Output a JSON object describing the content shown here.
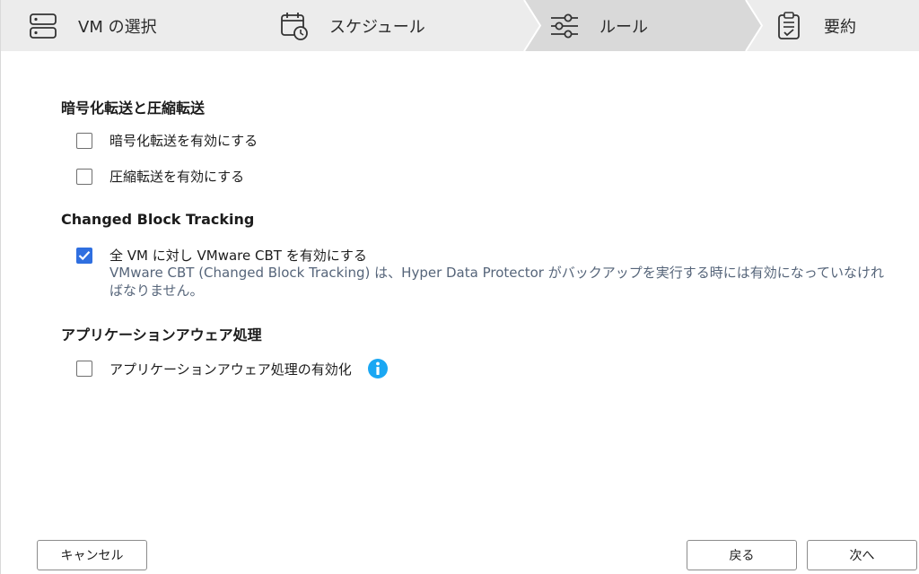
{
  "wizard": {
    "steps": [
      {
        "label": "VM の選択",
        "icon": "server-icon",
        "active": false
      },
      {
        "label": "スケジュール",
        "icon": "calendar-clock-icon",
        "active": false
      },
      {
        "label": "ルール",
        "icon": "sliders-icon",
        "active": true
      },
      {
        "label": "要約",
        "icon": "clipboard-check-icon",
        "active": false
      }
    ],
    "active_color": "#d9d9d9",
    "bar_color": "#ececec"
  },
  "transfer": {
    "title": "暗号化転送と圧縮転送",
    "encrypt_label": "暗号化転送を有効にする",
    "encrypt_checked": false,
    "compress_label": "圧縮転送を有効にする",
    "compress_checked": false
  },
  "cbt": {
    "title": "Changed Block Tracking",
    "enable_label": "全 VM に対し VMware CBT を有効にする",
    "enable_checked": true,
    "description": "VMware CBT (Changed Block Tracking) は、Hyper Data Protector がバックアップを実行する時には有効になっていなければなりません。"
  },
  "app_aware": {
    "title": "アプリケーションアウェア処理",
    "enable_label": "アプリケーションアウェア処理の有効化",
    "enable_checked": false,
    "info_icon": "info-icon"
  },
  "footer": {
    "cancel_label": "キャンセル",
    "back_label": "戻る",
    "next_label": "次へ"
  },
  "colors": {
    "checkbox_checked": "#2f6fe0",
    "info": "#1aa7f3",
    "description_text": "#56657a"
  }
}
